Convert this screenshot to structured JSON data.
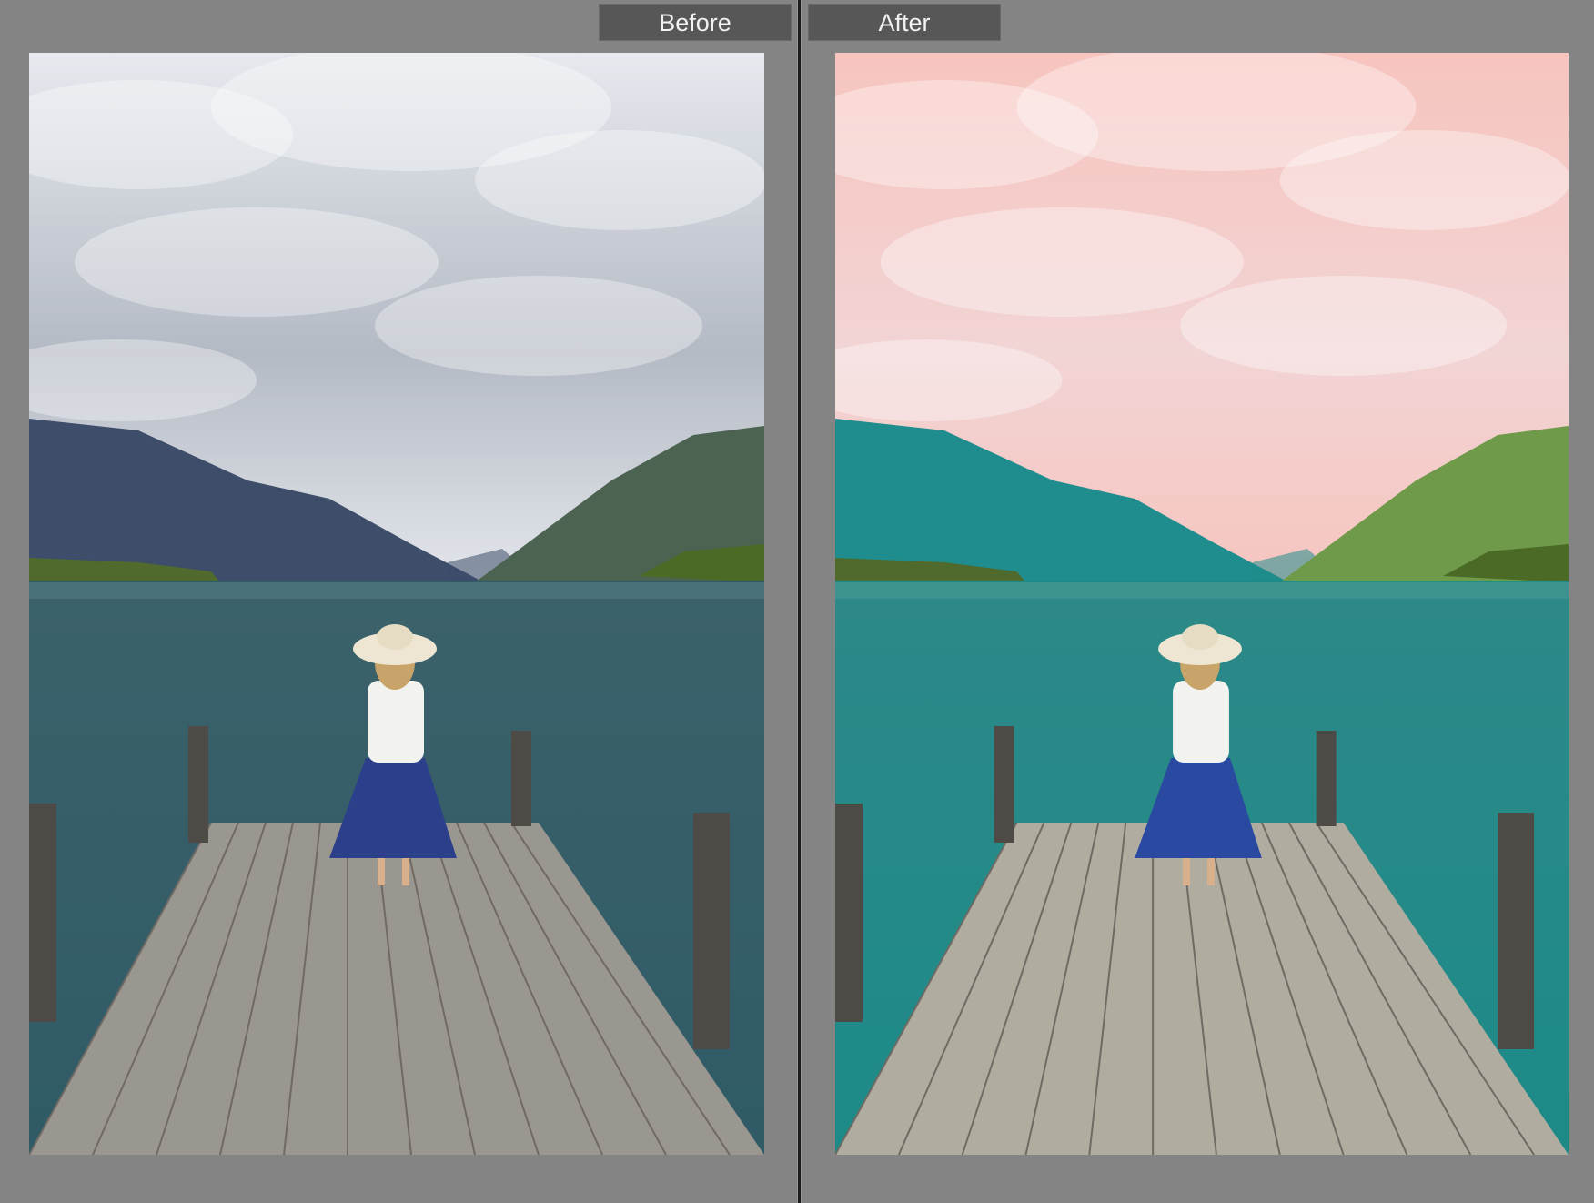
{
  "compare": {
    "before_label": "Before",
    "after_label": "After"
  },
  "colors": {
    "background": "#848484",
    "tab_background": "#575757",
    "divider": "#1c1c1c",
    "tab_text": "#f2f2f2"
  },
  "photos": {
    "before": {
      "sky_top": "#e6e9ee",
      "sky_mid": "#b4bac4",
      "mountain_left": "#3d4d6a",
      "mountain_right": "#4d6352",
      "water": "#2f5b66",
      "dock": "#9a9690",
      "skirt": "#2c3f8a"
    },
    "after": {
      "sky_top": "#f7c4be",
      "sky_mid": "#f1d4d4",
      "mountain_left": "#1f8d8d",
      "mountain_right": "#6f9a4a",
      "water": "#1d8a88",
      "dock": "#b1aca0",
      "skirt": "#2a4aa2"
    }
  }
}
